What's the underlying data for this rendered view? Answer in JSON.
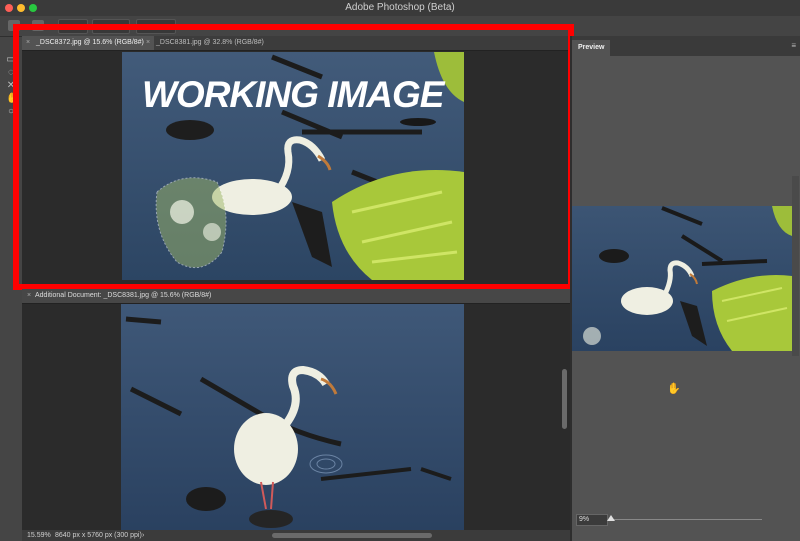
{
  "app": {
    "title": "Adobe Photoshop (Beta)"
  },
  "tools": [
    "marquee-icon",
    "lasso-icon",
    "crop-icon",
    "hand-icon",
    "zoom-icon"
  ],
  "document_tabs": [
    {
      "label": "_DSC8372.jpg @ 15.6% (RGB/8#)",
      "active": true
    },
    {
      "label": "_DSC8381.jpg @ 32.8% (RGB/8#)",
      "active": false
    }
  ],
  "working_overlay": "WORKING IMAGE",
  "additional_document": {
    "label": "Additional Document: _DSC8381.jpg @ 15.6% (RGB/8#)"
  },
  "status": {
    "zoom": "15.59%",
    "dimensions": "8640 px x 5760 px (300 ppi)",
    "arrow": "›"
  },
  "panel": {
    "tab": "Preview",
    "menu": "≡",
    "zoom_value": "9%"
  },
  "colors": {
    "highlight": "#ff0000",
    "water": "#365072",
    "foliage": "#a8c83a",
    "ibis": "#f0f0e0"
  }
}
